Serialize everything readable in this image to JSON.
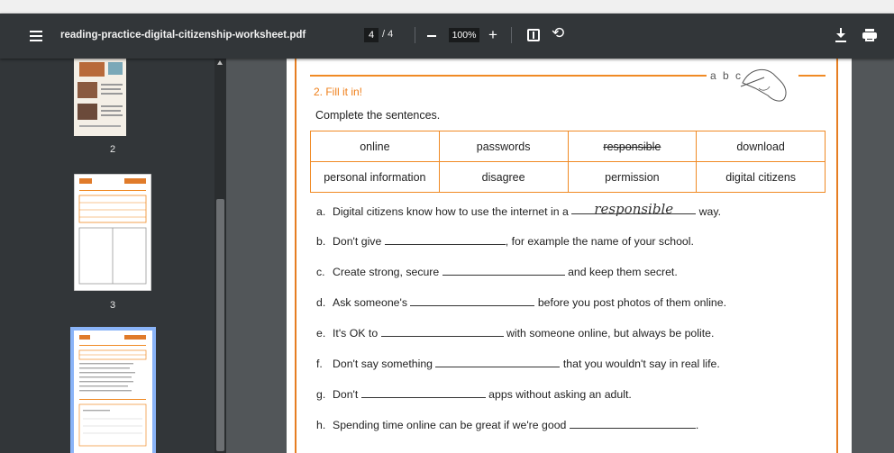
{
  "toolbar": {
    "title": "reading-practice-digital-citizenship-worksheet.pdf",
    "current_page": "4",
    "page_total": "/ 4",
    "zoom": "100%"
  },
  "sidebar": {
    "thumbnails": [
      {
        "label": "2"
      },
      {
        "label": "3"
      },
      {
        "label": ""
      }
    ]
  },
  "worksheet": {
    "header_letters": "a b c",
    "section_title": "2. Fill it in!",
    "instruction": "Complete the sentences.",
    "word_bank": [
      [
        "online",
        "passwords",
        "responsible",
        "download"
      ],
      [
        "personal information",
        "disagree",
        "permission",
        "digital citizens"
      ]
    ],
    "sentences": [
      {
        "label": "a.",
        "before": "Digital citizens know how to use the internet in a",
        "answer": "responsible",
        "after": "way."
      },
      {
        "label": "b.",
        "before": "Don't give",
        "answer": "",
        "after": ", for example the name of your school."
      },
      {
        "label": "c.",
        "before": "Create strong, secure",
        "answer": "",
        "after": "and keep them secret."
      },
      {
        "label": "d.",
        "before": "Ask someone's",
        "answer": "",
        "after": "before you post photos of them online."
      },
      {
        "label": "e.",
        "before": "It's OK to",
        "answer": "",
        "after": "with someone online, but always be polite."
      },
      {
        "label": "f.",
        "before": "Don't say something",
        "answer": "",
        "after": "that you wouldn't say in real life."
      },
      {
        "label": "g.",
        "before": "Don't",
        "answer": "",
        "after": "apps without asking an adult."
      },
      {
        "label": "h.",
        "before": "Spending time online can be great if we're good",
        "answer": "",
        "after": "."
      }
    ]
  },
  "colors": {
    "accent_orange": "#f08a24",
    "toolbar_bg": "#323639",
    "viewer_bg": "#525659"
  }
}
